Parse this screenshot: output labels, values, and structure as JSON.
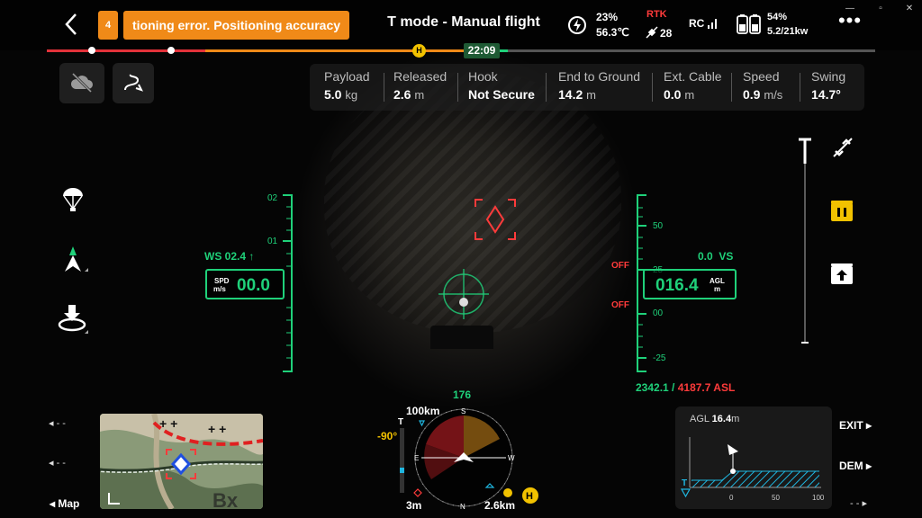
{
  "header": {
    "back_icon": "chevron-left-icon",
    "warning_count": "4",
    "warning_text": "tioning error. Positioning accuracy",
    "mode_title": "T mode - Manual flight",
    "aircraft_battery_percent": "23%",
    "aircraft_battery_temp": "56.3℃",
    "rtk_label": "RTK",
    "rtk_satellites": "28",
    "rc_label": "RC",
    "rc_battery_percent": "54%",
    "rc_battery_detail": "5.2/21kw",
    "more_icon": "more-dots-icon"
  },
  "timeline": {
    "time": "22:09",
    "home_marker": "H"
  },
  "telemetry": [
    {
      "label": "Payload",
      "value": "5.0",
      "unit": "kg"
    },
    {
      "label": "Released",
      "value": "2.6",
      "unit": "m"
    },
    {
      "label": "Hook",
      "value": "Not Secure",
      "unit": ""
    },
    {
      "label": "End to Ground",
      "value": "14.2",
      "unit": "m"
    },
    {
      "label": "Ext. Cable",
      "value": "0.0",
      "unit": "m"
    },
    {
      "label": "Speed",
      "value": "0.9",
      "unit": "m/s"
    },
    {
      "label": "Swing",
      "value": "14.7°",
      "unit": ""
    }
  ],
  "hud": {
    "ws": "WS 02.4",
    "spd_label_1": "SPD",
    "spd_label_2": "m/s",
    "spd_value": "00.0",
    "left_ticks": [
      "02",
      "01"
    ],
    "vs": "0.0",
    "vs_label": "VS",
    "agl_value": "016.4",
    "agl_label_1": "AGL",
    "agl_label_2": "m",
    "right_ticks": [
      "50",
      "25",
      "00",
      "-25"
    ],
    "off_1": "OFF",
    "off_2": "OFF",
    "alt_green": "2342.1 /",
    "alt_red": "4187.7 ASL"
  },
  "compass": {
    "heading": "176",
    "distance_top": "100km",
    "distance_bottom_left": "3m",
    "distance_bottom_right": "2.6km",
    "gimbal_pitch": "-90°",
    "north": "N",
    "south": "S",
    "east": "E",
    "west": "W",
    "home": "H"
  },
  "map": {
    "label": "Map"
  },
  "profile": {
    "agl_label": "AGL",
    "agl_value": "16.4",
    "agl_unit": "m",
    "axis": [
      "0",
      "50",
      "100"
    ]
  },
  "right_panel": {
    "exit_label": "EXIT",
    "dem_label": "DEM"
  },
  "colors": {
    "accent_orange": "#f08a18",
    "hud_green": "#1fd17a",
    "alert_red": "#ff3b3b",
    "home_yellow": "#f2c200"
  }
}
